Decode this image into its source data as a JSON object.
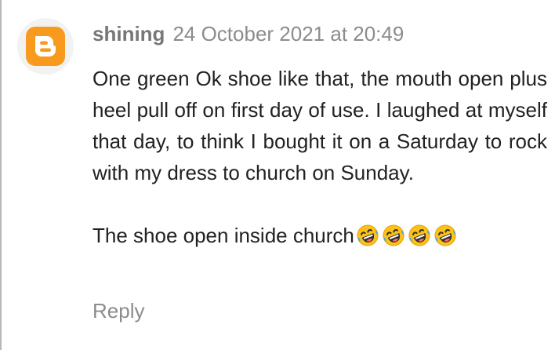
{
  "comment": {
    "author": "shining",
    "timestamp": "24 October 2021 at 20:49",
    "avatar_icon": "blogger-logo-icon",
    "avatar_color": "#f79a1e",
    "paragraphs": [
      "One green Ok shoe like that, the mouth open plus heel pull off on first day of use. I laughed at myself that day, to think I bought it on a Saturday to rock with my dress to church on Sunday.",
      "The shoe open inside church"
    ],
    "emoji_icon": "rolling-on-floor-laughing-emoji",
    "emoji_count": 4,
    "reply_label": "Reply"
  }
}
